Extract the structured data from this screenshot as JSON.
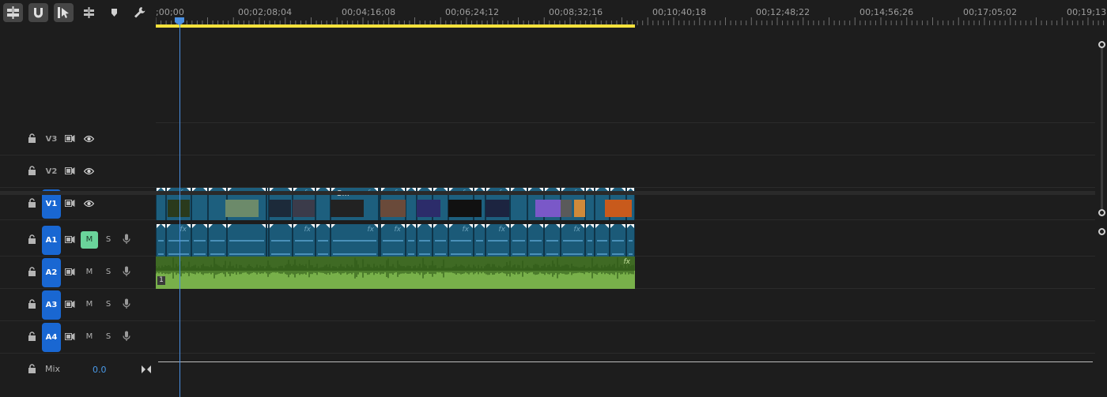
{
  "toolbar": {
    "tools": [
      "insert-and-overwrite-icon",
      "snap-magnet-icon",
      "selection-tool-icon",
      "linked-selection-icon",
      "marker-icon",
      "wrench-icon"
    ]
  },
  "ruler": {
    "timecodes": [
      ";00;00",
      "00;02;08;04",
      "00;04;16;08",
      "00;06;24;12",
      "00;08;32;16",
      "00;10;40;18",
      "00;12;48;22",
      "00;14;56;26",
      "00;17;05;02",
      "00;19;13;"
    ]
  },
  "tracks": {
    "video": [
      {
        "id": "V3",
        "targeted": false
      },
      {
        "id": "V2",
        "targeted": false
      },
      {
        "id": "V1",
        "targeted": true
      }
    ],
    "audio": [
      {
        "id": "A1",
        "targeted": true,
        "mute_label": "M",
        "solo_label": "S",
        "muted": true
      },
      {
        "id": "A2",
        "targeted": true,
        "mute_label": "M",
        "solo_label": "S",
        "muted": false
      },
      {
        "id": "A3",
        "targeted": true,
        "mute_label": "M",
        "solo_label": "S",
        "muted": false
      },
      {
        "id": "A4",
        "targeted": true,
        "mute_label": "M",
        "solo_label": "S",
        "muted": false
      }
    ],
    "mix": {
      "label": "Mix",
      "value": "0.0"
    }
  },
  "clips": {
    "v1_title_clip": "S...",
    "fx_label": "fx",
    "a2_channel": "1"
  },
  "colors": {
    "accent": "#1967d2",
    "playhead": "#4a90e2",
    "work_area": "#f4e23c",
    "video_clip": "#1d5f7e",
    "audio_clip_a2": "#78b04a",
    "mute_active": "#6ad49b"
  }
}
